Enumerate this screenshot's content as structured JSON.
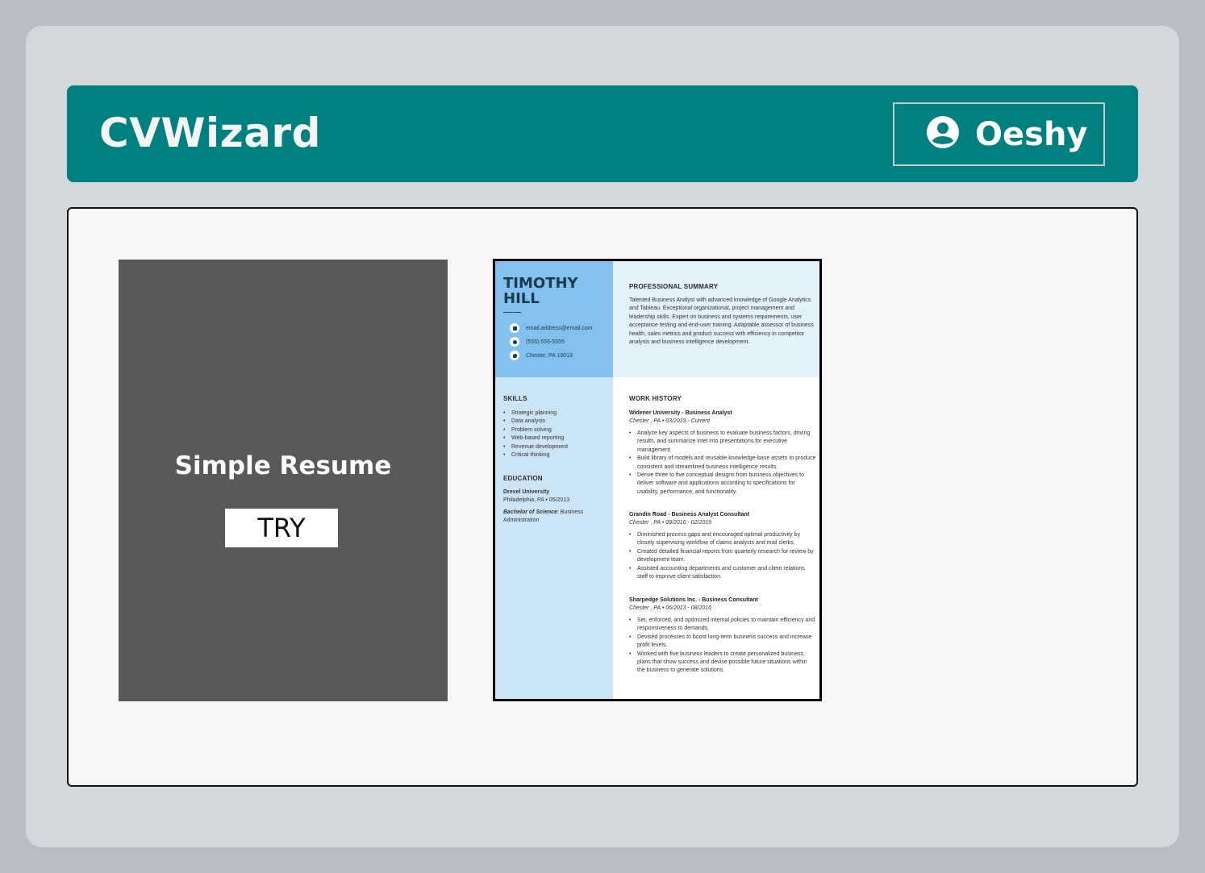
{
  "app": {
    "brand": "CVWizard"
  },
  "user": {
    "name": "Oeshy",
    "icon": "user-circle-icon"
  },
  "templates": [
    {
      "title": "Simple Resume",
      "action_label": "TRY"
    }
  ],
  "resume_preview": {
    "name_line1": "TIMOTHY",
    "name_line2": "HILL",
    "contacts": [
      {
        "icon": "email-icon",
        "text": "email.address@email.com"
      },
      {
        "icon": "phone-icon",
        "text": "(555) 555-5555"
      },
      {
        "icon": "location-icon",
        "text": "Chester, PA 19013"
      }
    ],
    "summary_heading": "PROFESSIONAL SUMMARY",
    "summary_text": "Talented Business Analyst with advanced knowledge of Google Analytics and Tableau. Exceptional organizational, project management and leadership skills. Expert on business and systems requirements, user acceptance testing and end-user training. Adaptable assessor of business health, sales metrics and product success with efficiency in competitor analysis and business intelligence development.",
    "skills_heading": "SKILLS",
    "skills": [
      "Strategic planning",
      "Data analysis",
      "Problem solving",
      "Web-based reporting",
      "Revenue development",
      "Critical thinking"
    ],
    "education_heading": "EDUCATION",
    "education_school": "Drexel University",
    "education_place": "Philadelphia, PA • 05/2013",
    "education_degree": "Bachelor of Science",
    "education_field": ": Business Administration",
    "work_heading": "WORK HISTORY",
    "jobs": [
      {
        "title": "Widener University - Business Analyst",
        "meta": "Chester , PA • 03/2019 - Current",
        "bullets": [
          "Analyze key aspects of business to evaluate business factors, driving results, and summarize intel into presentations for executive management.",
          "Build library of models and reusable knowledge-base assets to produce consistent and streamlined business intelligence results.",
          "Derive three to five conceptual designs from business objectives to deliver software and applications according to specifications for usability, performance, and functionality."
        ]
      },
      {
        "title": "Grandin Road - Business Analyst Consultant",
        "meta": "Chester , PA • 09/2016 - 02/2019",
        "bullets": [
          "Diminished process gaps and encouraged optimal productivity by closely supervising workflow of claims analysts and mail clerks.",
          "Created detailed financial reports from quarterly research for review by development team.",
          "Assisted accounting departments and customer and client relations staff to improve client satisfaction."
        ]
      },
      {
        "title": "Sharpedge Solutions Inc. - Business Consultant",
        "meta": "Chester , PA • 06/2013 - 08/2016",
        "bullets": [
          "Set, enforced, and optimized internal policies to maintain efficiency and responsiveness to demands.",
          "Devised processes to boost long-term business success and increase profit levels.",
          "Worked with five business leaders to create personalized business plans that show success and devise possible future situations within the business to generate solutions."
        ]
      }
    ]
  },
  "colors": {
    "header_bg": "#008080",
    "tile_bg": "#595959",
    "resume_sidebar_top": "#82c0ee",
    "resume_sidebar": "#cbe5f7",
    "resume_summary_bg": "#e3f1fb"
  }
}
